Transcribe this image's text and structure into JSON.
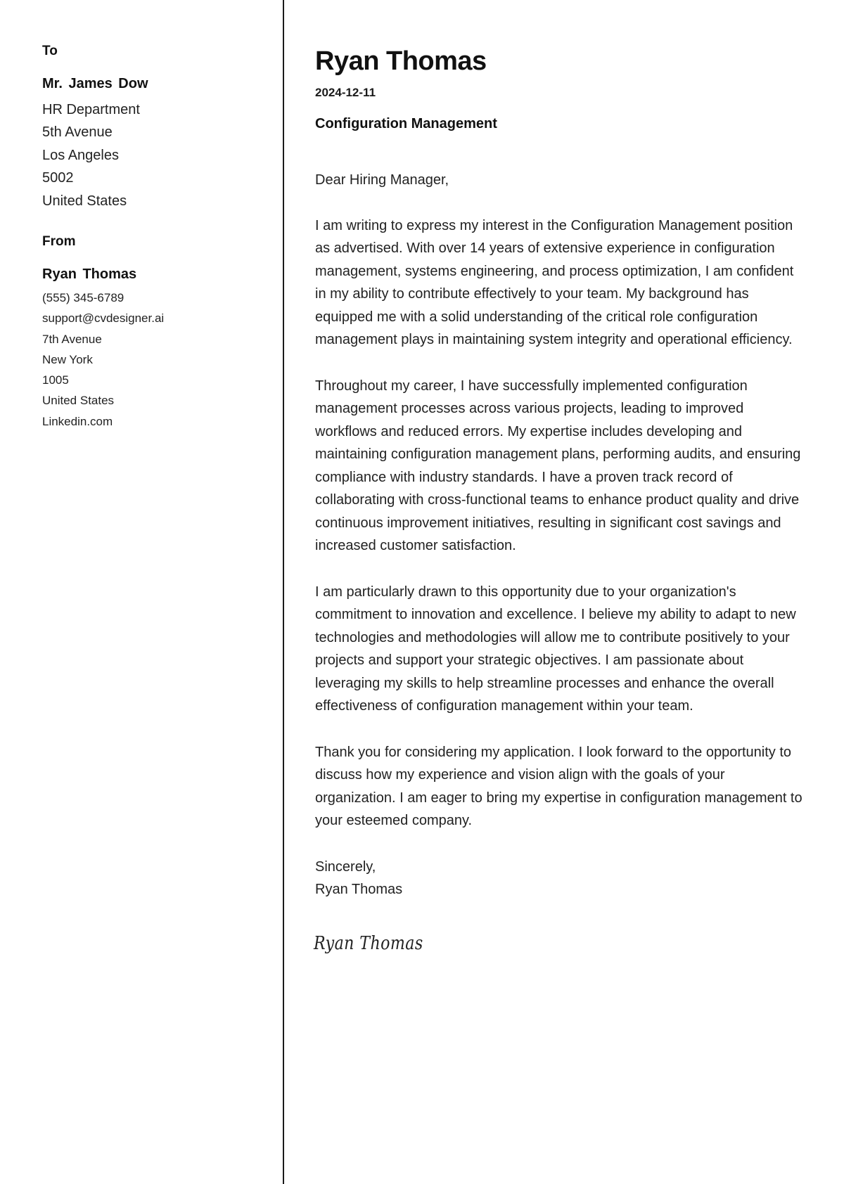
{
  "recipient": {
    "section_label": "To",
    "name": "Mr. James Dow",
    "lines": [
      "HR Department",
      "5th Avenue",
      "Los Angeles",
      "5002",
      "United States"
    ]
  },
  "sender": {
    "section_label": "From",
    "name": "Ryan Thomas",
    "phone": "(555) 345-6789",
    "email": "support@cvdesigner.ai",
    "street": "7th Avenue",
    "city": "New York",
    "postal_code": "1005",
    "country": "United States",
    "website": "Linkedin.com"
  },
  "letter": {
    "author_name": "Ryan Thomas",
    "date": "2024-12-11",
    "subject": "Configuration Management",
    "salutation": "Dear Hiring Manager,",
    "paragraphs": [
      "I am writing to express my interest in the Configuration Management position as advertised. With over 14 years of extensive experience in configuration management, systems engineering, and process optimization, I am confident in my ability to contribute effectively to your team. My background has equipped me with a solid understanding of the critical role configuration management plays in maintaining system integrity and operational efficiency.",
      "Throughout my career, I have successfully implemented configuration management processes across various projects, leading to improved workflows and reduced errors. My expertise includes developing and maintaining configuration management plans, performing audits, and ensuring compliance with industry standards. I have a proven track record of collaborating with cross-functional teams to enhance product quality and drive continuous improvement initiatives, resulting in significant cost savings and increased customer satisfaction.",
      "I am particularly drawn to this opportunity due to your organization's commitment to innovation and excellence. I believe my ability to adapt to new technologies and methodologies will allow me to contribute positively to your projects and support your strategic objectives. I am passionate about leveraging my skills to help streamline processes and enhance the overall effectiveness of configuration management within your team.",
      "Thank you for considering my application. I look forward to the opportunity to discuss how my experience and vision align with the goals of your organization. I am eager to bring my expertise in configuration management to your esteemed company."
    ],
    "closing": "Sincerely,",
    "closing_name": "Ryan Thomas",
    "signature": "Ryan Thomas"
  }
}
